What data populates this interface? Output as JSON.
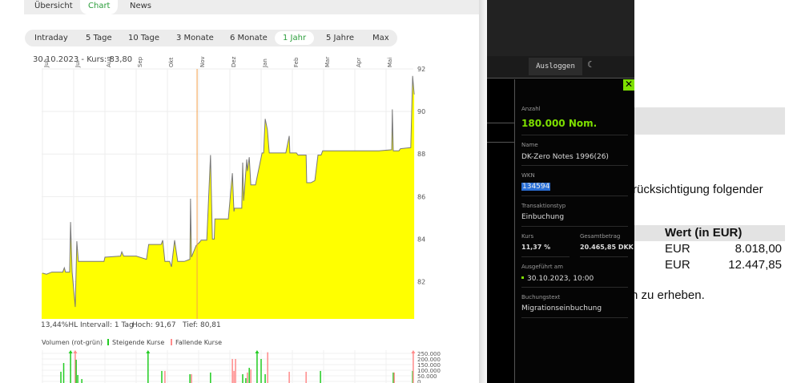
{
  "tabs": [
    {
      "label": "Übersicht",
      "active": false
    },
    {
      "label": "Chart",
      "active": true
    },
    {
      "label": "News",
      "active": false
    }
  ],
  "ranges": [
    {
      "label": "Intraday"
    },
    {
      "label": "5 Tage"
    },
    {
      "label": "10 Tage"
    },
    {
      "label": "3 Monate"
    },
    {
      "label": "6 Monate"
    },
    {
      "label": "1 Jahr",
      "active": true
    },
    {
      "label": "5 Jahre"
    },
    {
      "label": "Max"
    }
  ],
  "chart_header": "30.10.2023  -  Kurs: 83,80",
  "stats": {
    "hl": "13,44%HL",
    "interval": "Intervall: 1 Tag",
    "high": "Hoch:  91,67",
    "low": "Tief:  80,81"
  },
  "volume_legend": {
    "title": "Volumen (rot-grün)",
    "up": "Steigende Kurse",
    "down": "Fallende Kurse"
  },
  "chart_data": [
    {
      "type": "area",
      "title": "Kurs 1 Jahr",
      "fill": "#ffff00",
      "line": "#777777",
      "highlight_color": "#f5a04a",
      "months": [
        "Jun",
        "Jul",
        "Aug",
        "Sep",
        "Okt",
        "Nov",
        "Dez",
        "Jan",
        "Feb",
        "Mar",
        "Apr",
        "Mai"
      ],
      "yticks": [
        82,
        84,
        86,
        88,
        90,
        92
      ],
      "ylim": [
        80.25,
        92
      ],
      "highlight_month": 4.95,
      "x": [
        0,
        0.13,
        0.3,
        0.65,
        0.7,
        0.74,
        0.87,
        0.9,
        0.95,
        1.05,
        1.1,
        1.15,
        1.97,
        2.0,
        2.5,
        2.54,
        2.6,
        3.0,
        3.33,
        3.4,
        3.8,
        3.85,
        3.92,
        4.07,
        4.13,
        4.23,
        4.33,
        4.54,
        4.72,
        4.74,
        4.77,
        4.92,
        5.03,
        5.08,
        5.26,
        5.38,
        5.44,
        5.5,
        5.52,
        5.95,
        6.08,
        6.13,
        6.15,
        6.38,
        6.41,
        6.44,
        6.54,
        6.56,
        6.62,
        6.67,
        6.82,
        7.03,
        7.08,
        7.13,
        7.2,
        7.26,
        7.79,
        7.9,
        7.92,
        8.13,
        8.18,
        8.44,
        8.46,
        8.59,
        8.72,
        8.82,
        8.92,
        8.97,
        10.77,
        11.18,
        11.2,
        11.23,
        11.41,
        11.46,
        11.79,
        11.85,
        11.9
      ],
      "y": [
        82.4,
        82.35,
        82.45,
        82.45,
        82.65,
        82.45,
        82.45,
        84.8,
        82.45,
        80.81,
        83.9,
        82.95,
        82.95,
        83.15,
        83.2,
        83.4,
        83.2,
        83.2,
        83.05,
        83.75,
        83.75,
        83.95,
        82.95,
        82.95,
        82.7,
        83.95,
        82.95,
        82.95,
        83.05,
        85.9,
        83.15,
        83.7,
        83.85,
        83.95,
        83.95,
        87.95,
        84.0,
        84.0,
        84.95,
        84.95,
        87.1,
        85.3,
        85.45,
        85.45,
        87.6,
        85.8,
        87.75,
        87.2,
        87.85,
        86.55,
        86.55,
        88.05,
        88.05,
        89.65,
        89.15,
        88.05,
        88.05,
        88.85,
        88.05,
        88.05,
        87.95,
        87.95,
        86.65,
        86.65,
        86.75,
        87.95,
        87.95,
        88.15,
        88.15,
        88.2,
        90.1,
        88.15,
        88.15,
        88.25,
        88.3,
        91.67,
        90.8
      ]
    },
    {
      "type": "bar",
      "title": "Volumen",
      "yticks": [
        "250.000",
        "200.000",
        "150.000",
        "100.000",
        "50.000",
        "0"
      ],
      "ytick_values": [
        250000,
        200000,
        150000,
        100000,
        50000,
        0
      ],
      "ylim": [
        0,
        280000
      ],
      "up_color": "#22cc22",
      "down_color": "#ff8a8a",
      "bars": [
        [
          0.59,
          86000,
          "up"
        ],
        [
          0.68,
          164000,
          "up"
        ],
        [
          0.9,
          300000,
          "up"
        ],
        [
          1.05,
          300000,
          "down"
        ],
        [
          1.08,
          193000,
          "up"
        ],
        [
          1.13,
          57000,
          "up"
        ],
        [
          1.26,
          21000,
          "up"
        ],
        [
          3.38,
          300000,
          "up"
        ],
        [
          3.82,
          93000,
          "up"
        ],
        [
          3.92,
          93000,
          "down"
        ],
        [
          4.72,
          64000,
          "up"
        ],
        [
          4.77,
          64000,
          "down"
        ],
        [
          5.38,
          79000,
          "up"
        ],
        [
          6.08,
          200000,
          "down"
        ],
        [
          6.13,
          93000,
          "down"
        ],
        [
          6.18,
          200000,
          "down"
        ],
        [
          6.41,
          64000,
          "up"
        ],
        [
          6.51,
          29000,
          "up"
        ],
        [
          6.56,
          79000,
          "down"
        ],
        [
          6.62,
          121000,
          "up"
        ],
        [
          6.67,
          107000,
          "down"
        ],
        [
          6.87,
          279000,
          "up"
        ],
        [
          7.0,
          200000,
          "up"
        ],
        [
          7.13,
          64000,
          "up"
        ],
        [
          7.21,
          260000,
          "down"
        ],
        [
          7.9,
          86000,
          "down"
        ],
        [
          8.44,
          86000,
          "down"
        ],
        [
          8.9,
          93000,
          "up"
        ],
        [
          11.23,
          79000,
          "up"
        ],
        [
          11.26,
          79000,
          "down"
        ],
        [
          11.85,
          93000,
          "up"
        ],
        [
          11.87,
          280000,
          "down"
        ]
      ]
    }
  ],
  "nav": {
    "logout": "Ausloggen",
    "theme_icon": "moon-icon"
  },
  "detail": {
    "close": "✕",
    "anzahl_label": "Anzahl",
    "anzahl": "180.000 Nom.",
    "name_label": "Name",
    "name": "DK-Zero Notes 1996(26)",
    "wkn_label": "WKN",
    "wkn": "134594",
    "typ_label": "Transaktionstyp",
    "typ": "Einbuchung",
    "kurs_label": "Kurs",
    "kurs": "11,37 %",
    "betrag_label": "Gesamtbetrag",
    "betrag": "20.465,85 DKK",
    "date_label": "Ausgeführt am",
    "date": "30.10.2023, 10:00",
    "text_label": "Buchungstext",
    "text": "Migrationseinbuchung",
    "accent": "#7ee000"
  },
  "doc": {
    "line1": "rücksichtigung folgender",
    "table_header": "Wert (in EUR)",
    "rows": [
      {
        "cur": "EUR",
        "val": "8.018,00"
      },
      {
        "cur": "EUR",
        "val": "12.447,85"
      }
    ],
    "line2": "n zu erheben."
  }
}
